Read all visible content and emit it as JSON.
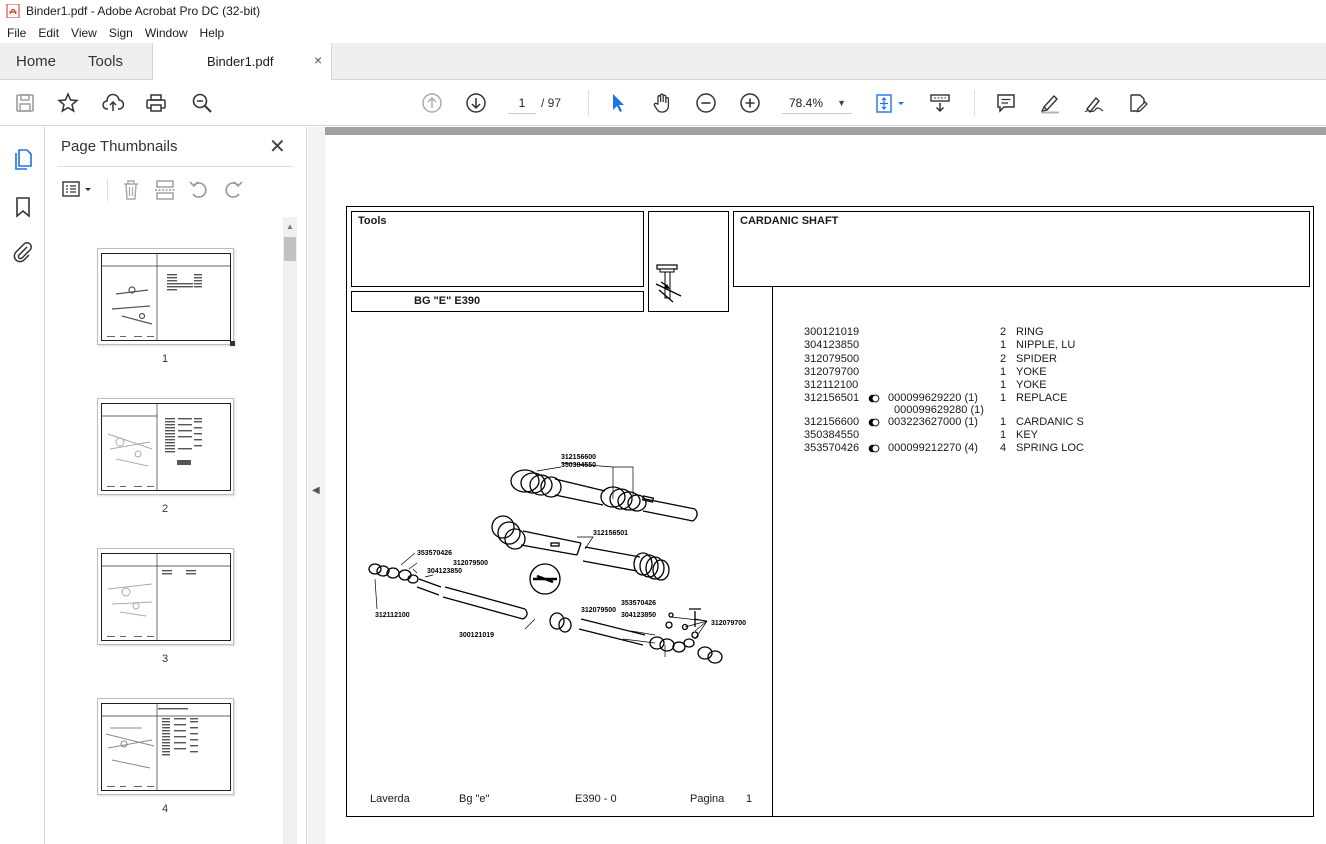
{
  "window": {
    "title": "Binder1.pdf - Adobe Acrobat Pro DC (32-bit)"
  },
  "menu": [
    "File",
    "Edit",
    "View",
    "Sign",
    "Window",
    "Help"
  ],
  "tabs": {
    "home": "Home",
    "tools": "Tools",
    "document": "Binder1.pdf",
    "close": "×"
  },
  "toolbar": {
    "current_page": "1",
    "page_total": "/ 97",
    "zoom": "78.4%"
  },
  "thumbnails": {
    "title": "Page Thumbnails",
    "close": "✕",
    "pages": [
      {
        "label": "1"
      },
      {
        "label": "2"
      },
      {
        "label": "3"
      },
      {
        "label": "4"
      }
    ]
  },
  "document": {
    "section": "Tools",
    "model": "BG \"E\"  E390",
    "heading": "CARDANIC SHAFT",
    "parts": [
      {
        "part": "300121019",
        "alt": "",
        "alt2": "",
        "qty": "2",
        "desc": "RING",
        "dot": false
      },
      {
        "part": "304123850",
        "alt": "",
        "alt2": "",
        "qty": "1",
        "desc": "NIPPLE, LU",
        "dot": false
      },
      {
        "part": "312079500",
        "alt": "",
        "alt2": "",
        "qty": "2",
        "desc": "SPIDER",
        "dot": false
      },
      {
        "part": "312079700",
        "alt": "",
        "alt2": "",
        "qty": "1",
        "desc": "YOKE",
        "dot": false
      },
      {
        "part": "312112100",
        "alt": "",
        "alt2": "",
        "qty": "1",
        "desc": "YOKE",
        "dot": false
      },
      {
        "part": "312156501",
        "alt": "000099629220  (1)",
        "alt2": "000099629280  (1)",
        "qty": "1",
        "desc": "REPLACE",
        "dot": true
      },
      {
        "part": "312156600",
        "alt": "003223627000  (1)",
        "alt2": "",
        "qty": "1",
        "desc": "CARDANIC S",
        "dot": true
      },
      {
        "part": "350384550",
        "alt": "",
        "alt2": "",
        "qty": "1",
        "desc": "KEY",
        "dot": false
      },
      {
        "part": "353570426",
        "alt": "000099212270  (4)",
        "alt2": "",
        "qty": "4",
        "desc": "SPRING LOC",
        "dot": true
      }
    ],
    "callouts": {
      "c1": "312156600",
      "c2": "350384550",
      "c3": "312156501",
      "c4": "353570426",
      "c5": "312079500",
      "c6": "304123850",
      "c7": "312112100",
      "c8": "300121019",
      "c9": "312079500",
      "c10": "353570426",
      "c11": "304123850",
      "c12": "312079700"
    },
    "footer": {
      "brand": "Laverda",
      "model": "Bg \"e\"",
      "code": "E390 - 0",
      "page_word": "Pagina",
      "page_num": "1"
    }
  }
}
